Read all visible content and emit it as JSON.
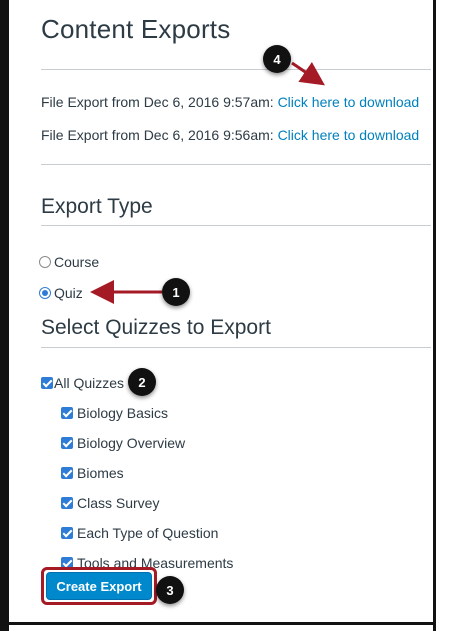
{
  "page": {
    "title": "Content Exports"
  },
  "exports": [
    {
      "text": "File Export from Dec 6, 2016 9:57am: ",
      "link": "Click here to download"
    },
    {
      "text": "File Export from Dec 6, 2016 9:56am: ",
      "link": "Click here to download"
    }
  ],
  "export_type": {
    "heading": "Export Type",
    "options": [
      {
        "label": "Course",
        "selected": false
      },
      {
        "label": "Quiz",
        "selected": true
      }
    ]
  },
  "quizzes": {
    "heading": "Select Quizzes to Export",
    "all_label": "All Quizzes",
    "items": [
      {
        "label": "Biology Basics",
        "checked": true
      },
      {
        "label": "Biology Overview",
        "checked": true
      },
      {
        "label": "Biomes",
        "checked": true
      },
      {
        "label": "Class Survey",
        "checked": true
      },
      {
        "label": "Each Type of Question",
        "checked": true
      },
      {
        "label": "Tools and Measurements",
        "checked": true
      }
    ]
  },
  "actions": {
    "create_export": "Create Export"
  },
  "callouts": [
    "1",
    "2",
    "3",
    "4"
  ],
  "colors": {
    "link": "#0081bd",
    "accent": "#2e7cd6",
    "button": "#0088cc",
    "annotation_red": "#a41a25"
  }
}
